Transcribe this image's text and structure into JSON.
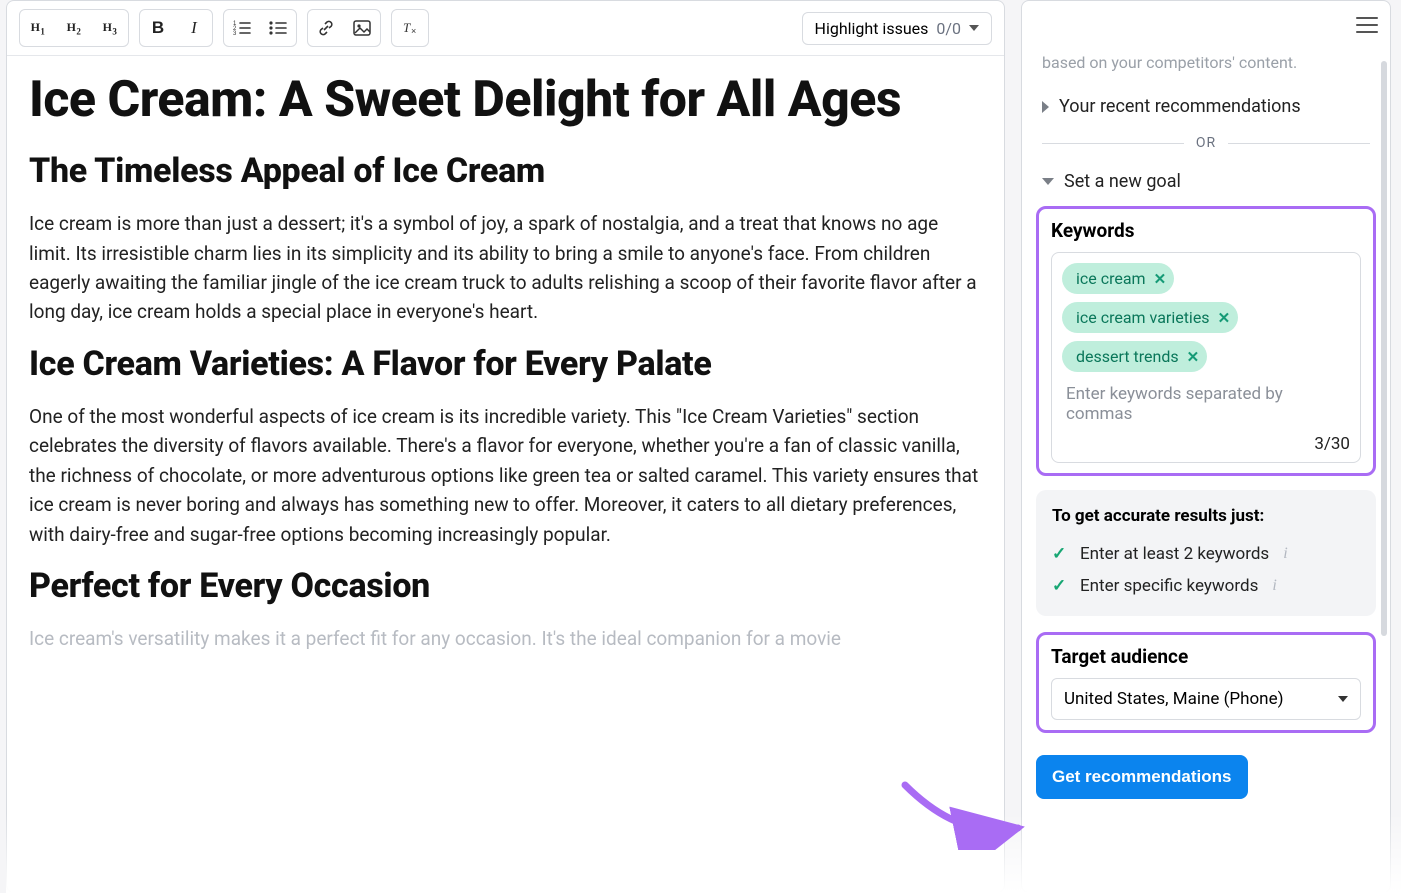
{
  "toolbar": {
    "h1": "H1",
    "h2": "H2",
    "h3": "H3",
    "bold": "B",
    "italic": "I",
    "ol_icon": "ordered-list-icon",
    "ul_icon": "unordered-list-icon",
    "link_icon": "link-icon",
    "image_icon": "image-icon",
    "clear_icon": "clear-formatting-icon",
    "highlight_label": "Highlight issues",
    "highlight_count": "0/0"
  },
  "article": {
    "title": "Ice Cream: A Sweet Delight for All Ages",
    "h2_1": "The Timeless Appeal of Ice Cream",
    "p1": "Ice cream is more than just a dessert; it's a symbol of joy, a spark of nostalgia, and a treat that knows no age limit. Its irresistible charm lies in its simplicity and its ability to bring a smile to anyone's face. From children eagerly awaiting the familiar jingle of the ice cream truck to adults relishing a scoop of their favorite flavor after a long day, ice cream holds a special place in everyone's heart.",
    "h2_2": "Ice Cream Varieties: A Flavor for Every Palate",
    "p2": "One of the most wonderful aspects of ice cream is its incredible variety. This \"Ice Cream Varieties\" section celebrates the diversity of flavors available. There's a flavor for everyone, whether you're a fan of classic vanilla, the richness of chocolate, or more adventurous options like green tea or salted caramel. This variety ensures that ice cream is never boring and always has something new to offer. Moreover, it caters to all dietary preferences, with dairy-free and sugar-free options becoming increasingly popular.",
    "h2_3": "Perfect for Every Occasion",
    "p3": "Ice cream's versatility makes it a perfect fit for any occasion. It's the ideal companion for a movie"
  },
  "sidebar": {
    "faded_hint": "based on your competitors' content.",
    "recent_label": "Your recent recommendations",
    "or_label": "OR",
    "new_goal_label": "Set a new goal",
    "keywords_title": "Keywords",
    "keywords": [
      "ice cream",
      "ice cream varieties",
      "dessert trends"
    ],
    "kw_placeholder": "Enter keywords separated by commas",
    "kw_count": "3/30",
    "tips_title": "To get accurate results just:",
    "tips": [
      "Enter at least 2 keywords",
      "Enter specific keywords"
    ],
    "audience_title": "Target audience",
    "audience_value": "United States, Maine (Phone)",
    "cta": "Get recommendations"
  }
}
